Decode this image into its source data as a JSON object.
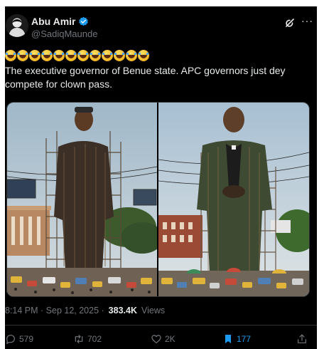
{
  "post": {
    "author_name": "Abu Amir",
    "handle": "@SadiqMaunde",
    "more_label": "···",
    "emoji_reaction": [
      "😂",
      "😂",
      "😂",
      "😂",
      "😂",
      "😂",
      "😂",
      "😂",
      "😂",
      "😂",
      "😂",
      "😂"
    ],
    "text": "The executive governor of Benue state. APC governors just dey compete for clown pass.",
    "timestamp": "8:14 PM · Sep 12, 2025 ·",
    "views_count": "383.4K",
    "views_label": "Views"
  },
  "actions": {
    "replies": "579",
    "reposts": "702",
    "likes": "2K",
    "bookmarks": "177"
  },
  "icons": {
    "verified": "verified-badge-icon",
    "grok": "grok-icon",
    "more": "more-options-icon",
    "reply": "reply-icon",
    "repost": "repost-icon",
    "like": "heart-icon",
    "bookmark": "bookmark-icon",
    "share": "share-icon"
  },
  "colors": {
    "background": "#000000",
    "text": "#e7e9ea",
    "muted": "#71767b",
    "accent": "#1d9bf0",
    "border": "#2f3336"
  }
}
